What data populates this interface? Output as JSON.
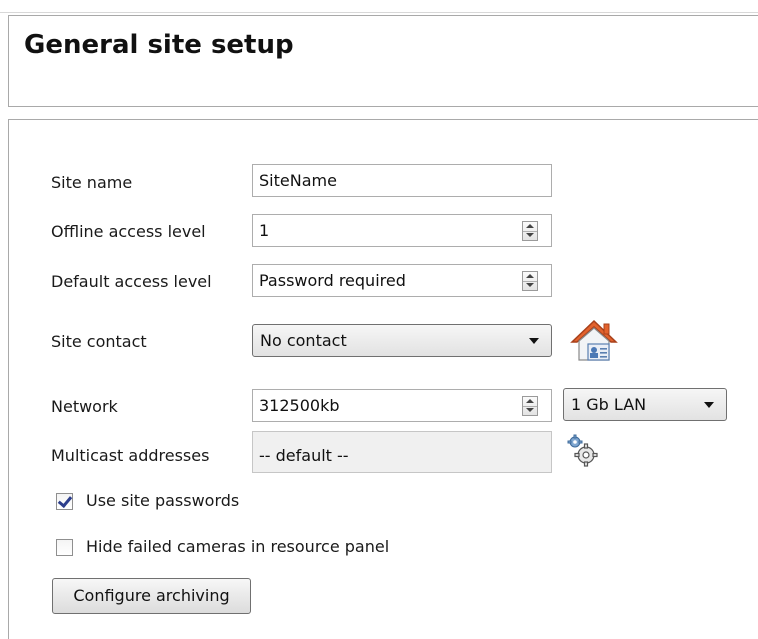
{
  "header": {
    "title": "General site setup"
  },
  "form": {
    "site_name": {
      "label": "Site name",
      "value": "SiteName"
    },
    "offline_access_level": {
      "label": "Offline access level",
      "value": "1"
    },
    "default_access_level": {
      "label": "Default access level",
      "value": "Password required"
    },
    "site_contact": {
      "label": "Site contact",
      "value": "No contact",
      "icon": "contact-home-icon"
    },
    "network": {
      "label": "Network",
      "value": "312500kb",
      "type_value": "1 Gb LAN"
    },
    "multicast_addresses": {
      "label": "Multicast addresses",
      "value": "-- default --",
      "icon": "gears-icon"
    },
    "use_site_passwords": {
      "label": "Use site passwords",
      "checked": true
    },
    "hide_failed_cameras": {
      "label": "Hide failed cameras in resource panel",
      "checked": false
    },
    "configure_archiving": {
      "label": "Configure archiving"
    }
  },
  "colors": {
    "house_roof": "#e2622d",
    "panel_border": "#a9a9a9",
    "check_mark": "#2c3e8c"
  }
}
